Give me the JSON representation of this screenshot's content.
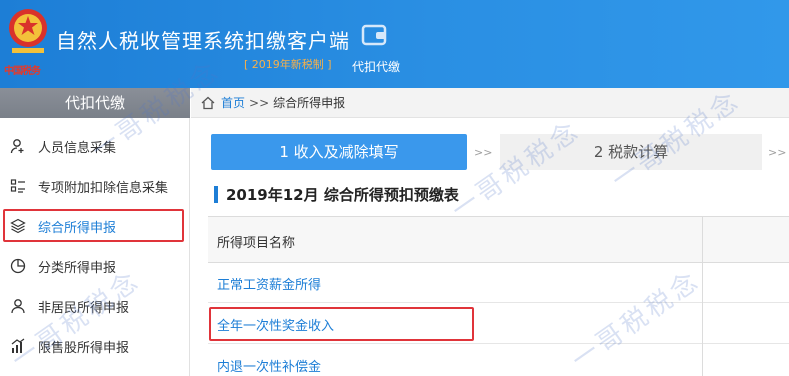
{
  "header": {
    "emblem_text": "中国税务",
    "app_title": "自然人税收管理系统扣缴客户端",
    "version": "[ 2019年新税制 ]",
    "module": "代扣代缴"
  },
  "sidebar": {
    "title": "代扣代缴",
    "items": [
      {
        "label": "人员信息采集",
        "icon": "user-add-icon"
      },
      {
        "label": "专项附加扣除信息采集",
        "icon": "list-icon"
      },
      {
        "label": "综合所得申报",
        "icon": "layers-icon"
      },
      {
        "label": "分类所得申报",
        "icon": "pie-chart-icon"
      },
      {
        "label": "非居民所得申报",
        "icon": "user-icon"
      },
      {
        "label": "限售股所得申报",
        "icon": "bar-chart-icon"
      }
    ]
  },
  "breadcrumb": {
    "home": "首页",
    "sep": ">>",
    "current": "综合所得申报"
  },
  "steps": {
    "step1": "1 收入及减除填写",
    "step2": "2 税款计算",
    "arrow": ">>"
  },
  "section": {
    "title": "2019年12月  综合所得预扣预缴表"
  },
  "table": {
    "header": "所得项目名称",
    "rows": [
      "正常工资薪金所得",
      "全年一次性奖金收入",
      "内退一次性补偿金"
    ]
  },
  "watermark": "一哥税税念",
  "colors": {
    "primary": "#1d7ed6",
    "highlight": "#e0343a",
    "version": "#f6b04a"
  }
}
